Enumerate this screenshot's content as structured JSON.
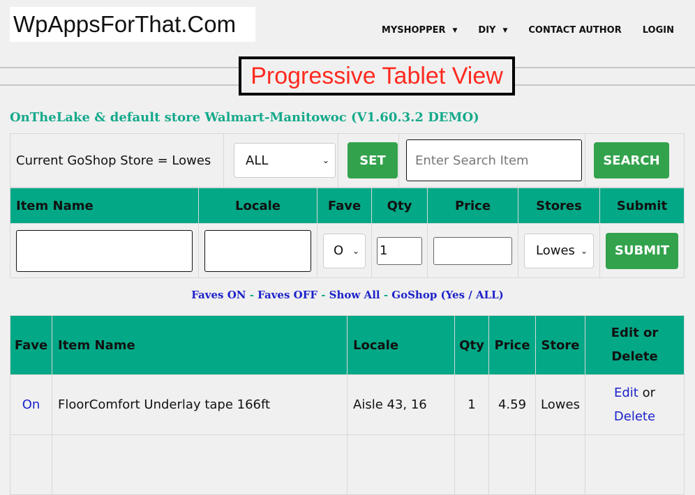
{
  "header": {
    "logo": "WpAppsForThat.Com",
    "nav": [
      {
        "label": "MYSHOPPER",
        "dropdown": true
      },
      {
        "label": "DIY",
        "dropdown": true
      },
      {
        "label": "CONTACT AUTHOR",
        "dropdown": false
      },
      {
        "label": "LOGIN",
        "dropdown": false
      }
    ],
    "caret": "▼"
  },
  "banner": "Progressive Tablet View",
  "subtitle": "OnTheLake & default store Walmart-Manitowoc (V1.60.3.2 DEMO)",
  "goshop": {
    "label": "Current GoShop Store = Lowes",
    "store_select": "ALL",
    "set_label": "SET",
    "search_placeholder": "Enter Search Item",
    "search_label": "SEARCH"
  },
  "add_form": {
    "headers": [
      "Item Name",
      "Locale",
      "Fave",
      "Qty",
      "Price",
      "Stores",
      "Submit"
    ],
    "item_name": "",
    "locale": "",
    "fave_select": "O",
    "qty": "1",
    "price": "",
    "store_select": "Lowes",
    "submit_label": "SUBMIT"
  },
  "filters": {
    "faves_on": "Faves ON",
    "faves_off": "Faves OFF",
    "show_all": "Show All",
    "goshop": "GoShop (Yes / ALL)",
    "separator": " - "
  },
  "list": {
    "headers": [
      "Fave",
      "Item Name",
      "Locale",
      "Qty",
      "Price",
      "Store",
      "Edit or Delete"
    ],
    "rows": [
      {
        "fave": "On",
        "item": "FloorComfort Underlay tape 166ft",
        "locale": "Aisle 43, 16",
        "qty": "1",
        "price": "4.59",
        "store": "Lowes",
        "edit": "Edit",
        "or": "or",
        "delete": "Delete"
      }
    ]
  },
  "icons": {
    "chevron": "⌄"
  },
  "colors": {
    "accent_green": "#03a886",
    "button_green": "#33a24d",
    "link_blue": "#1c22c8",
    "banner_red": "#ff2a1f"
  }
}
